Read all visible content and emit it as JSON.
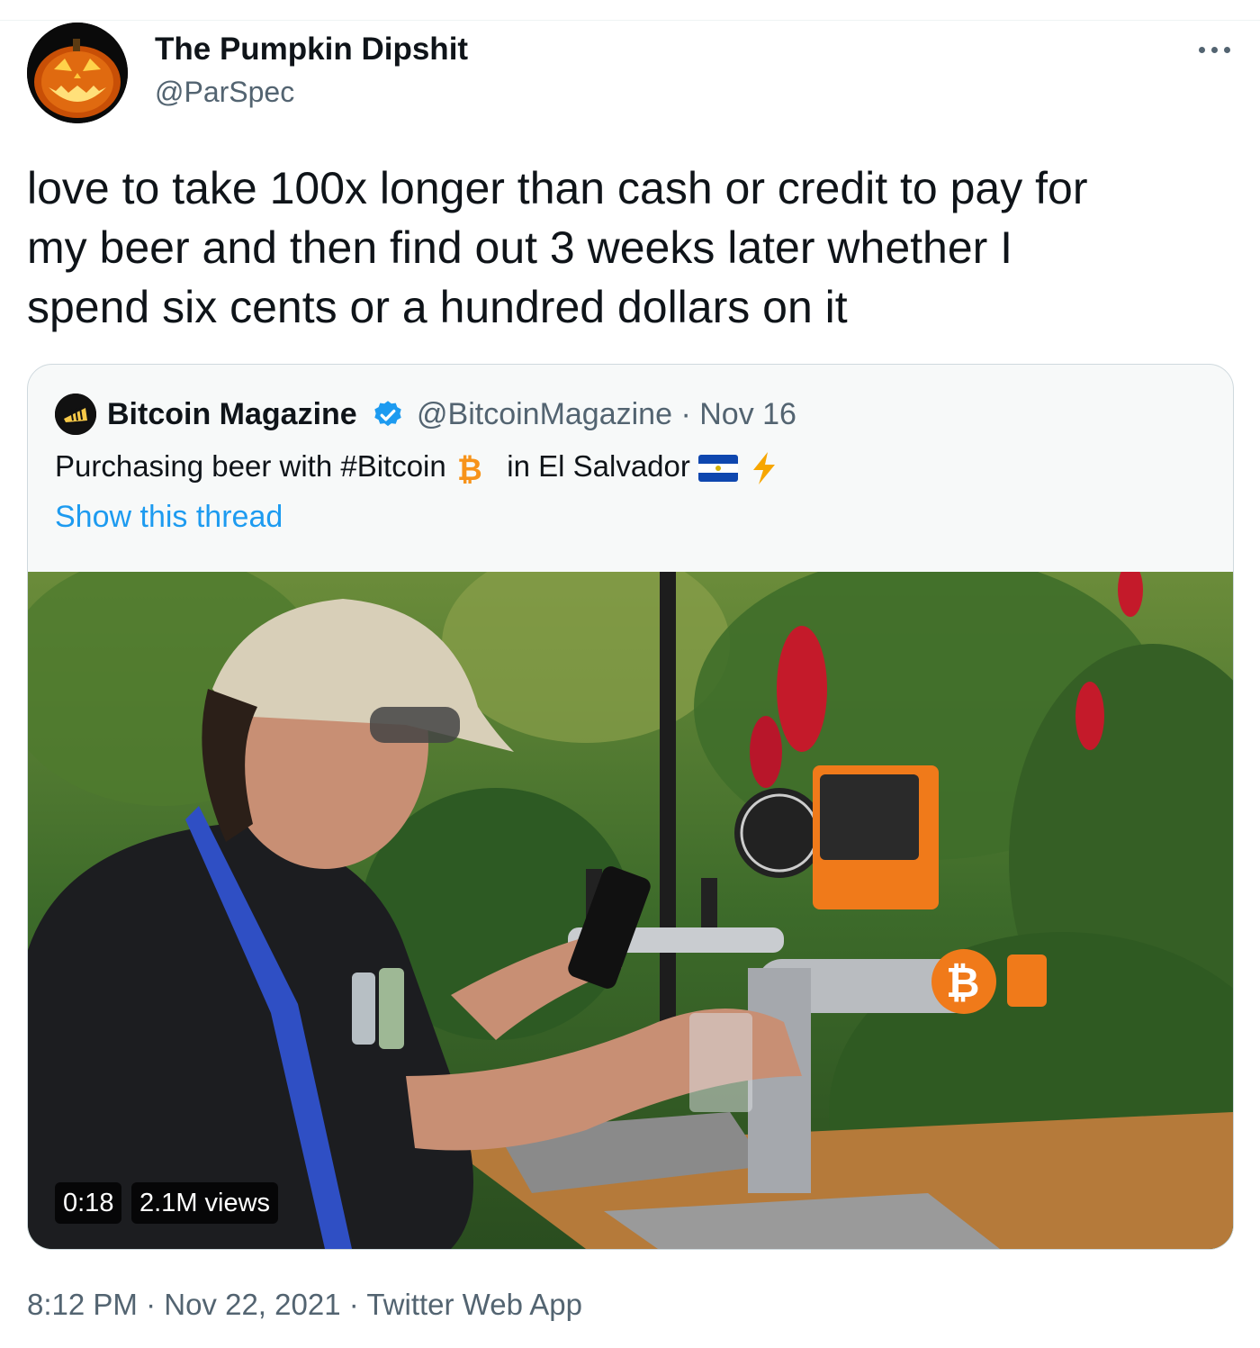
{
  "author": {
    "name": "The Pumpkin Dipshit",
    "handle": "@ParSpec"
  },
  "tweet": {
    "lines": [
      "love to take 100x longer than cash or credit to pay for",
      "my beer and then find out 3 weeks later whether I",
      "spend six cents or a hundred dollars on it"
    ]
  },
  "quoted": {
    "name": "Bitcoin Magazine",
    "handle": "@BitcoinMagazine",
    "date_sep": "·",
    "date": "Nov 16",
    "text_part1": "Purchasing beer with #Bitcoin",
    "text_part2": "in El Salvador",
    "show_thread": "Show this thread",
    "video": {
      "time": "0:18",
      "views": "2.1M views"
    }
  },
  "meta": {
    "time": "8:12 PM",
    "sep1": "·",
    "date": "Nov 22, 2021",
    "sep2": "·",
    "source": "Twitter Web App"
  },
  "colors": {
    "link": "#1d9bf0",
    "muted": "#536471",
    "verified": "#1d9bf0",
    "bitcoin_orange": "#f7931a"
  },
  "icons": [
    "pumpkin-avatar",
    "more-dots-icon",
    "bitcoin-magazine-logo",
    "verified-badge-icon",
    "bitcoin-icon",
    "el-salvador-flag-icon",
    "lightning-icon"
  ]
}
